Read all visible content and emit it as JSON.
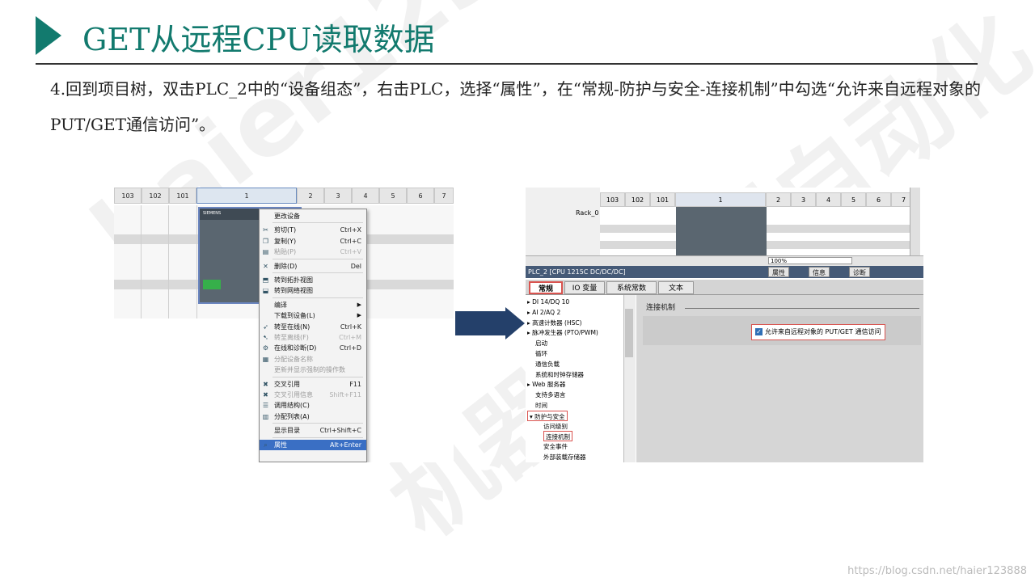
{
  "header": {
    "title": "GET从远程CPU读取数据"
  },
  "instruction": {
    "text": "4.回到项目树，双击PLC_2中的“设备组态”，右击PLC，选择“属性”，在“常规-防护与安全-连接机制”中勾选“允许来自远程对象的PUT/GET通信访问”。"
  },
  "watermark": {
    "text1": "haier123888",
    "text2": "机器人控制自动化",
    "url": "https://blog.csdn.net/haier123888"
  },
  "left_screenshot": {
    "slots": [
      "103",
      "102",
      "101",
      "1",
      "2",
      "3",
      "4",
      "5",
      "6",
      "7"
    ],
    "plc_brand": "SIEMENS",
    "context_menu": [
      {
        "label": "更改设备",
        "shortcut": "",
        "icon": "",
        "state": "normal"
      },
      {
        "label": "剪切(T)",
        "shortcut": "Ctrl+X",
        "icon": "scissors-icon",
        "state": "normal"
      },
      {
        "label": "复制(Y)",
        "shortcut": "Ctrl+C",
        "icon": "copy-icon",
        "state": "normal"
      },
      {
        "label": "粘贴(P)",
        "shortcut": "Ctrl+V",
        "icon": "paste-icon",
        "state": "disabled"
      },
      {
        "label": "删除(D)",
        "shortcut": "Del",
        "icon": "delete-icon",
        "state": "normal"
      },
      {
        "label": "转到拓扑视图",
        "shortcut": "",
        "icon": "topology-icon",
        "state": "normal"
      },
      {
        "label": "转到网络视图",
        "shortcut": "",
        "icon": "network-icon",
        "state": "normal"
      },
      {
        "label": "编译",
        "shortcut": "",
        "icon": "",
        "state": "submenu"
      },
      {
        "label": "下载到设备(L)",
        "shortcut": "",
        "icon": "",
        "state": "submenu"
      },
      {
        "label": "转至在线(N)",
        "shortcut": "Ctrl+K",
        "icon": "go-online-icon",
        "state": "normal"
      },
      {
        "label": "转至离线(F)",
        "shortcut": "Ctrl+M",
        "icon": "go-offline-icon",
        "state": "disabled"
      },
      {
        "label": "在线和诊断(D)",
        "shortcut": "Ctrl+D",
        "icon": "diagnostics-icon",
        "state": "normal"
      },
      {
        "label": "分配设备名称",
        "shortcut": "",
        "icon": "assign-name-icon",
        "state": "disabled"
      },
      {
        "label": "更新并显示强制的操作数",
        "shortcut": "",
        "icon": "",
        "state": "disabled"
      },
      {
        "label": "交叉引用",
        "shortcut": "F11",
        "icon": "cross-ref-icon",
        "state": "normal"
      },
      {
        "label": "交叉引用信息",
        "shortcut": "Shift+F11",
        "icon": "cross-ref-info-icon",
        "state": "disabled"
      },
      {
        "label": "调用结构(C)",
        "shortcut": "",
        "icon": "call-structure-icon",
        "state": "normal"
      },
      {
        "label": "分配列表(A)",
        "shortcut": "",
        "icon": "assignment-list-icon",
        "state": "normal"
      },
      {
        "label": "显示目录",
        "shortcut": "Ctrl+Shift+C",
        "icon": "",
        "state": "normal"
      },
      {
        "label": "属性",
        "shortcut": "Alt+Enter",
        "icon": "properties-icon",
        "state": "selected"
      }
    ]
  },
  "right_screenshot": {
    "rack_label": "Rack_0",
    "slots": [
      "103",
      "102",
      "101",
      "1",
      "2",
      "3",
      "4",
      "5",
      "6",
      "7"
    ],
    "zoom": "100%",
    "device_title": "PLC_2 [CPU 1215C DC/DC/DC]",
    "header_tabs": [
      "属性",
      "信息",
      "诊断"
    ],
    "tabs": [
      "常规",
      "IO 变量",
      "系统常数",
      "文本"
    ],
    "nav_items": [
      {
        "label": "DI 14/DQ 10",
        "arrow": "▸",
        "indent": 0,
        "boxed": false
      },
      {
        "label": "AI 2/AQ 2",
        "arrow": "▸",
        "indent": 0,
        "boxed": false
      },
      {
        "label": "高速计数器 (HSC)",
        "arrow": "▸",
        "indent": 0,
        "boxed": false
      },
      {
        "label": "脉冲发生器 (PTO/PWM)",
        "arrow": "▸",
        "indent": 0,
        "boxed": false
      },
      {
        "label": "启动",
        "arrow": "",
        "indent": 0,
        "boxed": false
      },
      {
        "label": "循环",
        "arrow": "",
        "indent": 0,
        "boxed": false
      },
      {
        "label": "通信负载",
        "arrow": "",
        "indent": 0,
        "boxed": false
      },
      {
        "label": "系统和时钟存储器",
        "arrow": "",
        "indent": 0,
        "boxed": false
      },
      {
        "label": "Web 服务器",
        "arrow": "▸",
        "indent": 0,
        "boxed": false
      },
      {
        "label": "支持多语言",
        "arrow": "",
        "indent": 0,
        "boxed": false
      },
      {
        "label": "时间",
        "arrow": "",
        "indent": 0,
        "boxed": false
      },
      {
        "label": "防护与安全",
        "arrow": "▾",
        "indent": 0,
        "boxed": true
      },
      {
        "label": "访问级别",
        "arrow": "",
        "indent": 1,
        "boxed": false
      },
      {
        "label": "连接机制",
        "arrow": "",
        "indent": 1,
        "boxed": true
      },
      {
        "label": "安全事件",
        "arrow": "",
        "indent": 1,
        "boxed": false
      },
      {
        "label": "外部装载存储器",
        "arrow": "",
        "indent": 1,
        "boxed": false
      }
    ],
    "section_title": "连接机制",
    "checkbox_label": "允许来自远程对象的 PUT/GET 通信访问",
    "checkbox_checked": true
  }
}
